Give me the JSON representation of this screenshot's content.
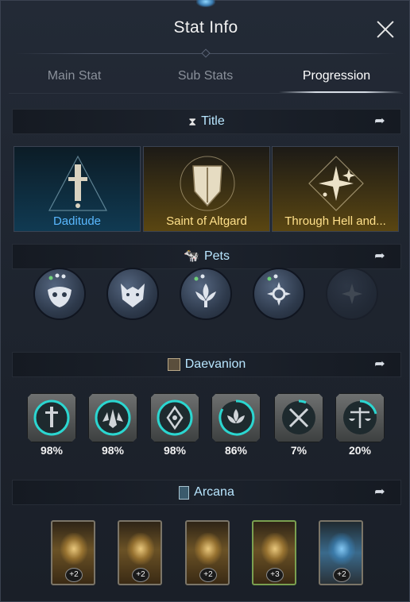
{
  "window": {
    "title": "Stat Info"
  },
  "tabs": [
    {
      "label": "Main Stat",
      "active": false
    },
    {
      "label": "Sub Stats",
      "active": false
    },
    {
      "label": "Progression",
      "active": true
    }
  ],
  "sections": {
    "title": {
      "label": "Title",
      "icon": "hourglass-icon"
    },
    "pets": {
      "label": "Pets",
      "icon": "pet-icon"
    },
    "daevanion": {
      "label": "Daevanion",
      "icon": "daevanion-icon"
    },
    "arcana": {
      "label": "Arcana",
      "icon": "arcana-card-icon"
    }
  },
  "titles": [
    {
      "label": "Daditude",
      "color": "#5ab8ff"
    },
    {
      "label": "Saint of Altgard",
      "color": "#ffe08a"
    },
    {
      "label": "Through Hell and...",
      "color": "#ffe08a"
    }
  ],
  "pets": [
    {
      "icon": "mask-pet-icon",
      "locked": false
    },
    {
      "icon": "wolf-pet-icon",
      "locked": false
    },
    {
      "icon": "lotus-pet-icon",
      "locked": false
    },
    {
      "icon": "sun-pet-icon",
      "locked": false
    },
    {
      "icon": "flower-pet-icon",
      "locked": true
    }
  ],
  "daevanion": [
    {
      "icon": "sword-emblem-icon",
      "progress": "98%"
    },
    {
      "icon": "wings-emblem-icon",
      "progress": "98%"
    },
    {
      "icon": "compass-emblem-icon",
      "progress": "98%"
    },
    {
      "icon": "lotus-emblem-icon",
      "progress": "86%"
    },
    {
      "icon": "crossed-swords-emblem-icon",
      "progress": "7%"
    },
    {
      "icon": "scales-emblem-icon",
      "progress": "20%"
    }
  ],
  "arcana": [
    {
      "badge": "+2",
      "style": "gold"
    },
    {
      "badge": "+2",
      "style": "gold"
    },
    {
      "badge": "+2",
      "style": "gold"
    },
    {
      "badge": "+3",
      "style": "gold-green"
    },
    {
      "badge": "+2",
      "style": "blue"
    }
  ],
  "colors": {
    "accent": "#b8e6ff",
    "title_blue": "#5ab8ff",
    "title_gold": "#ffe08a"
  }
}
